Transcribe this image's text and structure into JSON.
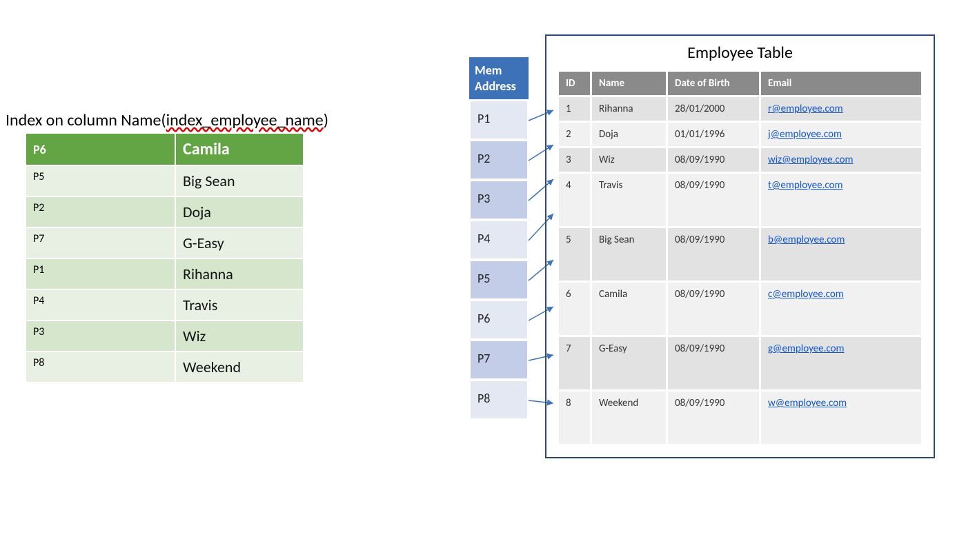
{
  "index": {
    "title_prefix": "Index on column Name(",
    "title_mid": "index_employee_name",
    "title_suffix": ")",
    "header_ptr": "P6",
    "header_name": "Camila",
    "rows": [
      {
        "ptr": "P5",
        "name": "Big Sean"
      },
      {
        "ptr": "P2",
        "name": "Doja"
      },
      {
        "ptr": "P7",
        "name": "G-Easy"
      },
      {
        "ptr": "P1",
        "name": "Rihanna"
      },
      {
        "ptr": "P4",
        "name": "Travis"
      },
      {
        "ptr": "P3",
        "name": "Wiz"
      },
      {
        "ptr": "P8",
        "name": "Weekend"
      }
    ]
  },
  "memory": {
    "header_line1": "Mem",
    "header_line2": "Address",
    "cells": [
      "P1",
      "P2",
      "P3",
      "P4",
      "P5",
      "P6",
      "P7",
      "P8"
    ]
  },
  "employee": {
    "title": "Employee Table",
    "headers": {
      "id": "ID",
      "name": "Name",
      "dob": "Date of Birth",
      "email": "Email"
    },
    "rows": [
      {
        "id": "1",
        "name": "Rihanna",
        "dob": "28/01/2000",
        "email": "r@employee.com"
      },
      {
        "id": "2",
        "name": "Doja",
        "dob": "01/01/1996",
        "email": "j@employee.com"
      },
      {
        "id": "3",
        "name": "Wiz",
        "dob": "08/09/1990",
        "email": "wiz@employee.com"
      },
      {
        "id": "4",
        "name": "Travis",
        "dob": "08/09/1990",
        "email": "t@employee.com"
      },
      {
        "id": "5",
        "name": "Big Sean",
        "dob": "08/09/1990",
        "email": "b@employee.com"
      },
      {
        "id": "6",
        "name": "Camila",
        "dob": "08/09/1990",
        "email": "c@employee.com"
      },
      {
        "id": "7",
        "name": "G-Easy",
        "dob": "08/09/1990",
        "email": "g@employee.com"
      },
      {
        "id": "8",
        "name": "Weekend",
        "dob": "08/09/1990",
        "email": "w@employee.com"
      }
    ]
  }
}
